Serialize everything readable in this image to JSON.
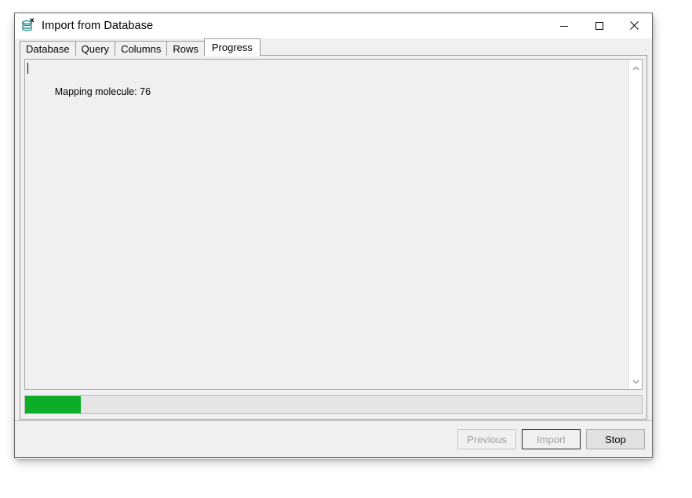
{
  "window": {
    "title": "Import from Database",
    "icon": "database-import-icon",
    "caption_buttons": [
      {
        "name": "minimize",
        "glyph": "minimize-icon"
      },
      {
        "name": "maximize",
        "glyph": "maximize-icon"
      },
      {
        "name": "close",
        "glyph": "close-icon"
      }
    ]
  },
  "tabs": [
    {
      "label": "Database",
      "selected": false
    },
    {
      "label": "Query",
      "selected": false
    },
    {
      "label": "Columns",
      "selected": false
    },
    {
      "label": "Rows",
      "selected": false
    },
    {
      "label": "Progress",
      "selected": true
    }
  ],
  "progress_page": {
    "log_text": "Mapping molecule: 76",
    "scrollbar": {
      "up_arrow": "chevron-up-icon",
      "down_arrow": "chevron-down-icon"
    },
    "progress": {
      "percent": 9,
      "fill_color": "#0cae28",
      "track_color": "#e6e6e6"
    }
  },
  "footer": {
    "buttons": [
      {
        "label": "Previous",
        "state": "disabled"
      },
      {
        "label": "Import",
        "state": "disabled-default"
      },
      {
        "label": "Stop",
        "state": "enabled"
      }
    ]
  }
}
